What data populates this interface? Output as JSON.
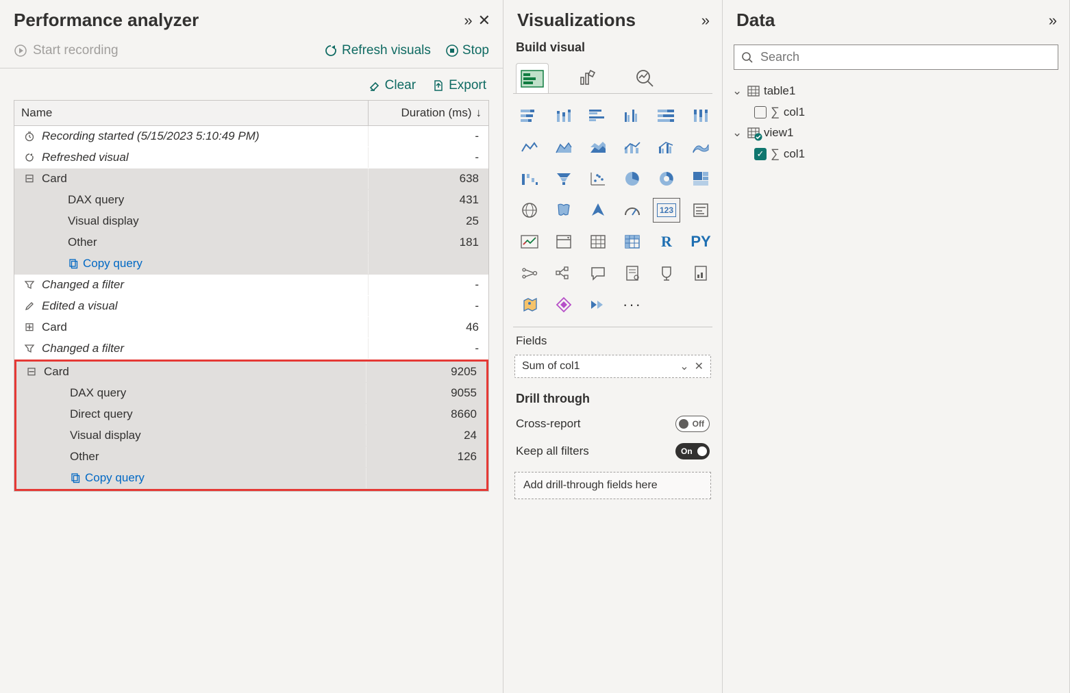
{
  "perf": {
    "title": "Performance analyzer",
    "start": "Start recording",
    "refresh": "Refresh visuals",
    "stop": "Stop",
    "clear": "Clear",
    "export": "Export",
    "col_name": "Name",
    "col_duration": "Duration (ms)",
    "rows": {
      "rec_started": "Recording started (5/15/2023 5:10:49 PM)",
      "refreshed": "Refreshed visual",
      "card1": "Card",
      "card1_dur": "638",
      "dax1": "DAX query",
      "dax1_dur": "431",
      "vis1": "Visual display",
      "vis1_dur": "25",
      "oth1": "Other",
      "oth1_dur": "181",
      "copy1": "Copy query",
      "chg1": "Changed a filter",
      "edit1": "Edited a visual",
      "card2": "Card",
      "card2_dur": "46",
      "chg2": "Changed a filter",
      "card3": "Card",
      "card3_dur": "9205",
      "dax3": "DAX query",
      "dax3_dur": "9055",
      "dq3": "Direct query",
      "dq3_dur": "8660",
      "vis3": "Visual display",
      "vis3_dur": "24",
      "oth3": "Other",
      "oth3_dur": "126",
      "copy3": "Copy query"
    },
    "dash": "-"
  },
  "viz": {
    "title": "Visualizations",
    "subtitle": "Build visual",
    "fields_label": "Fields",
    "field_value": "Sum of col1",
    "drill_title": "Drill through",
    "cross_report": "Cross-report",
    "keep_filters": "Keep all filters",
    "off": "Off",
    "on": "On",
    "drop_hint": "Add drill-through fields here",
    "more": "···",
    "r": "R",
    "py": "PY",
    "num": "123"
  },
  "data": {
    "title": "Data",
    "search_placeholder": "Search",
    "table1": "table1",
    "col1": "col1",
    "view1": "view1"
  }
}
